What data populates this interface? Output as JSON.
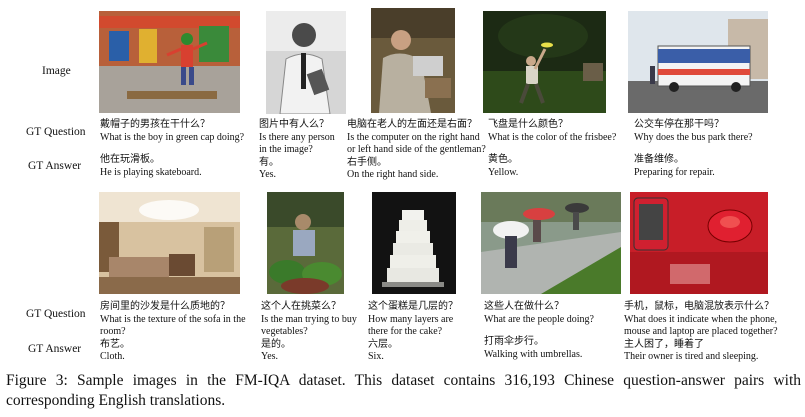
{
  "row_labels": {
    "image": "Image",
    "question1": "GT Question",
    "answer1": "GT Answer",
    "question2": "GT Question",
    "answer2": "GT Answer"
  },
  "samples": [
    {
      "q_zh": "戴帽子的男孩在干什么？",
      "q_en": "What is the boy in green cap doing?",
      "a_zh": "他在玩滑板。",
      "a_en": "He is playing skateboard."
    },
    {
      "q_zh": "图片中有人么？",
      "q_en": "Is there any person in the image?",
      "a_zh": "有。",
      "a_en": "Yes."
    },
    {
      "q_zh": "电脑在老人的左面还是右面？",
      "q_en": "Is the computer on the right hand or left hand side of the gentleman?",
      "a_zh": "右手侧。",
      "a_en": "On the right hand side."
    },
    {
      "q_zh": "飞盘是什么颜色？",
      "q_en": "What is the color of the frisbee?",
      "a_zh": "黄色。",
      "a_en": "Yellow."
    },
    {
      "q_zh": "公交车停在那干吗？",
      "q_en": "Why does the bus park there?",
      "a_zh": "准备维修。",
      "a_en": "Preparing for repair."
    },
    {
      "q_zh": "房间里的沙发是什么质地的？",
      "q_en": "What is the texture of the sofa in the room?",
      "a_zh": "布艺。",
      "a_en": "Cloth."
    },
    {
      "q_zh": "这个人在挑菜么？",
      "q_en": "Is the man trying to buy vegetables?",
      "a_zh": "是的。",
      "a_en": "Yes."
    },
    {
      "q_zh": "这个蛋糕是几层的？",
      "q_en": "How many layers are there for the cake?",
      "a_zh": "六层。",
      "a_en": "Six."
    },
    {
      "q_zh": "这些人在做什么？",
      "q_en": "What are the people doing?",
      "a_zh": "打雨伞步行。",
      "a_en": "Walking with umbrellas."
    },
    {
      "q_zh": "手机，鼠标，电脑混放表示什么？",
      "q_en": "What does it indicate when the phone, mouse and laptop are placed together?",
      "a_zh": "主人困了，睡着了",
      "a_en": "Their owner is tired and sleeping."
    }
  ],
  "caption": "Figure 3: Sample images in the FM-IQA dataset. This dataset contains 316,193 Chinese question-answer pairs with corresponding English translations."
}
